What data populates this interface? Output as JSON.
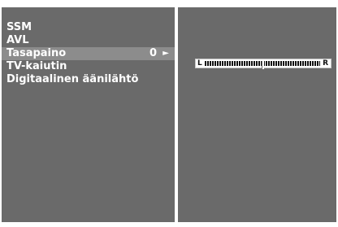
{
  "menu": {
    "items": [
      {
        "label": "SSM"
      },
      {
        "label": "AVL"
      },
      {
        "label": "Tasapaino",
        "value": "0",
        "arrow": "►"
      },
      {
        "label": "TV-kaiutin"
      },
      {
        "label": "Digitaalinen äänilähtö"
      }
    ],
    "selected_index": 2
  },
  "balance": {
    "left_label": "L",
    "right_label": "R",
    "value": 0,
    "min": -50,
    "max": 50
  },
  "colors": {
    "panel": "#6a6a6a",
    "highlight": "#8c8c8c",
    "text": "#ffffff"
  }
}
